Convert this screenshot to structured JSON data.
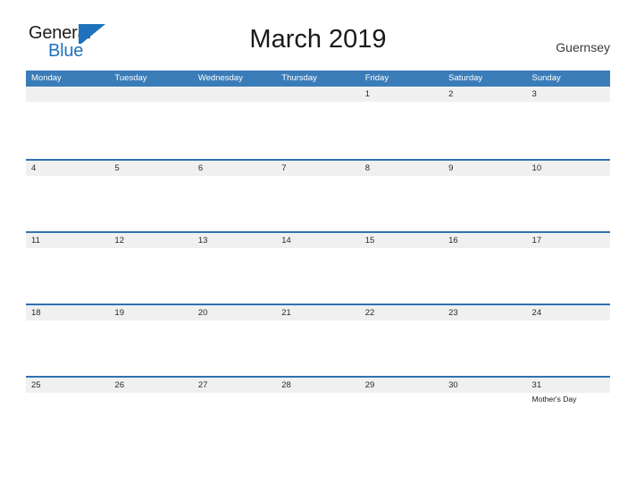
{
  "logo": {
    "text_top": "General",
    "text_bottom": "Blue",
    "mark": "triangle-flag",
    "color_primary": "#1f72bd",
    "color_text": "#1a1a1a"
  },
  "header": {
    "title": "March 2019",
    "region": "Guernsey"
  },
  "colors": {
    "header_blue": "#3a7cb8",
    "row_rule_blue": "#2e72b0",
    "day_strip_gray": "#f0f0f0",
    "page_background": "#ffffff"
  },
  "calendar": {
    "month": "March",
    "year": "2019",
    "weekdays": [
      "Monday",
      "Tuesday",
      "Wednesday",
      "Thursday",
      "Friday",
      "Saturday",
      "Sunday"
    ],
    "weeks": [
      {
        "days": [
          {
            "num": "",
            "events": []
          },
          {
            "num": "",
            "events": []
          },
          {
            "num": "",
            "events": []
          },
          {
            "num": "",
            "events": []
          },
          {
            "num": "1",
            "events": []
          },
          {
            "num": "2",
            "events": []
          },
          {
            "num": "3",
            "events": []
          }
        ]
      },
      {
        "days": [
          {
            "num": "4",
            "events": []
          },
          {
            "num": "5",
            "events": []
          },
          {
            "num": "6",
            "events": []
          },
          {
            "num": "7",
            "events": []
          },
          {
            "num": "8",
            "events": []
          },
          {
            "num": "9",
            "events": []
          },
          {
            "num": "10",
            "events": []
          }
        ]
      },
      {
        "days": [
          {
            "num": "11",
            "events": []
          },
          {
            "num": "12",
            "events": []
          },
          {
            "num": "13",
            "events": []
          },
          {
            "num": "14",
            "events": []
          },
          {
            "num": "15",
            "events": []
          },
          {
            "num": "16",
            "events": []
          },
          {
            "num": "17",
            "events": []
          }
        ]
      },
      {
        "days": [
          {
            "num": "18",
            "events": []
          },
          {
            "num": "19",
            "events": []
          },
          {
            "num": "20",
            "events": []
          },
          {
            "num": "21",
            "events": []
          },
          {
            "num": "22",
            "events": []
          },
          {
            "num": "23",
            "events": []
          },
          {
            "num": "24",
            "events": []
          }
        ]
      },
      {
        "days": [
          {
            "num": "25",
            "events": []
          },
          {
            "num": "26",
            "events": []
          },
          {
            "num": "27",
            "events": []
          },
          {
            "num": "28",
            "events": []
          },
          {
            "num": "29",
            "events": []
          },
          {
            "num": "30",
            "events": []
          },
          {
            "num": "31",
            "events": [
              "Mother's Day"
            ]
          }
        ]
      }
    ]
  }
}
